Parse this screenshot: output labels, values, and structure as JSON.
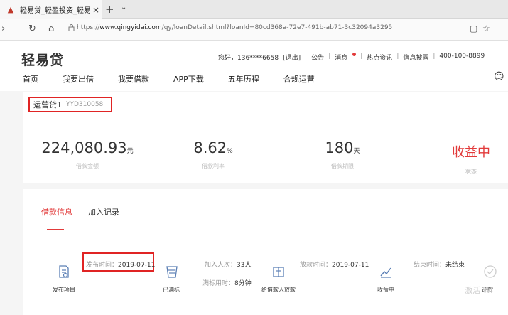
{
  "browser": {
    "tab_title": "轻易贷_轻盈投资_轻易!",
    "new_tab": "+",
    "url_prefix": "https://",
    "url_domain": "www.qingyidai.com",
    "url_path": "/qy/loanDetail.shtml?loanId=80cd368a-72e7-491b-ab71-3c32094a3295"
  },
  "site": {
    "logo": "轻易贷",
    "topbar": {
      "greeting": "您好，136****6658",
      "logout": "[退出]",
      "notice": "公告",
      "message": "消息",
      "hot": "热点资讯",
      "disclosure": "信息披露",
      "phone": "400-100-8899"
    },
    "nav": [
      "首页",
      "我要出借",
      "我要借款",
      "APP下载",
      "五年历程",
      "合规运营"
    ]
  },
  "loan": {
    "title": "运营贷1",
    "code": "YYD310058",
    "stats": [
      {
        "value": "224,080.93",
        "unit": "元",
        "label": "借款金额"
      },
      {
        "value": "8.62",
        "unit": "%",
        "label": "借款利率"
      },
      {
        "value": "180",
        "unit": "天",
        "label": "借款期限"
      },
      {
        "value": "收益中",
        "unit": "",
        "label": "状态"
      }
    ]
  },
  "tabs": {
    "active": "借款信息",
    "other": "加入记录"
  },
  "timeline": {
    "publish_key": "发布时间：",
    "publish_val": "2019-07-11",
    "publish_label": "发布项目",
    "joined_key": "加入人次：",
    "joined_val": "33人",
    "full_key": "满标用时：",
    "full_val": "8分钟",
    "full_label": "已满标",
    "lend_key": "放款时间：",
    "lend_val": "2019-07-11",
    "lend_label": "给借款人放款",
    "end_key": "结束时间：",
    "end_val": "未结束",
    "earning_label": "收益中",
    "last_label": "还款",
    "watermark": "激活 Wi"
  }
}
